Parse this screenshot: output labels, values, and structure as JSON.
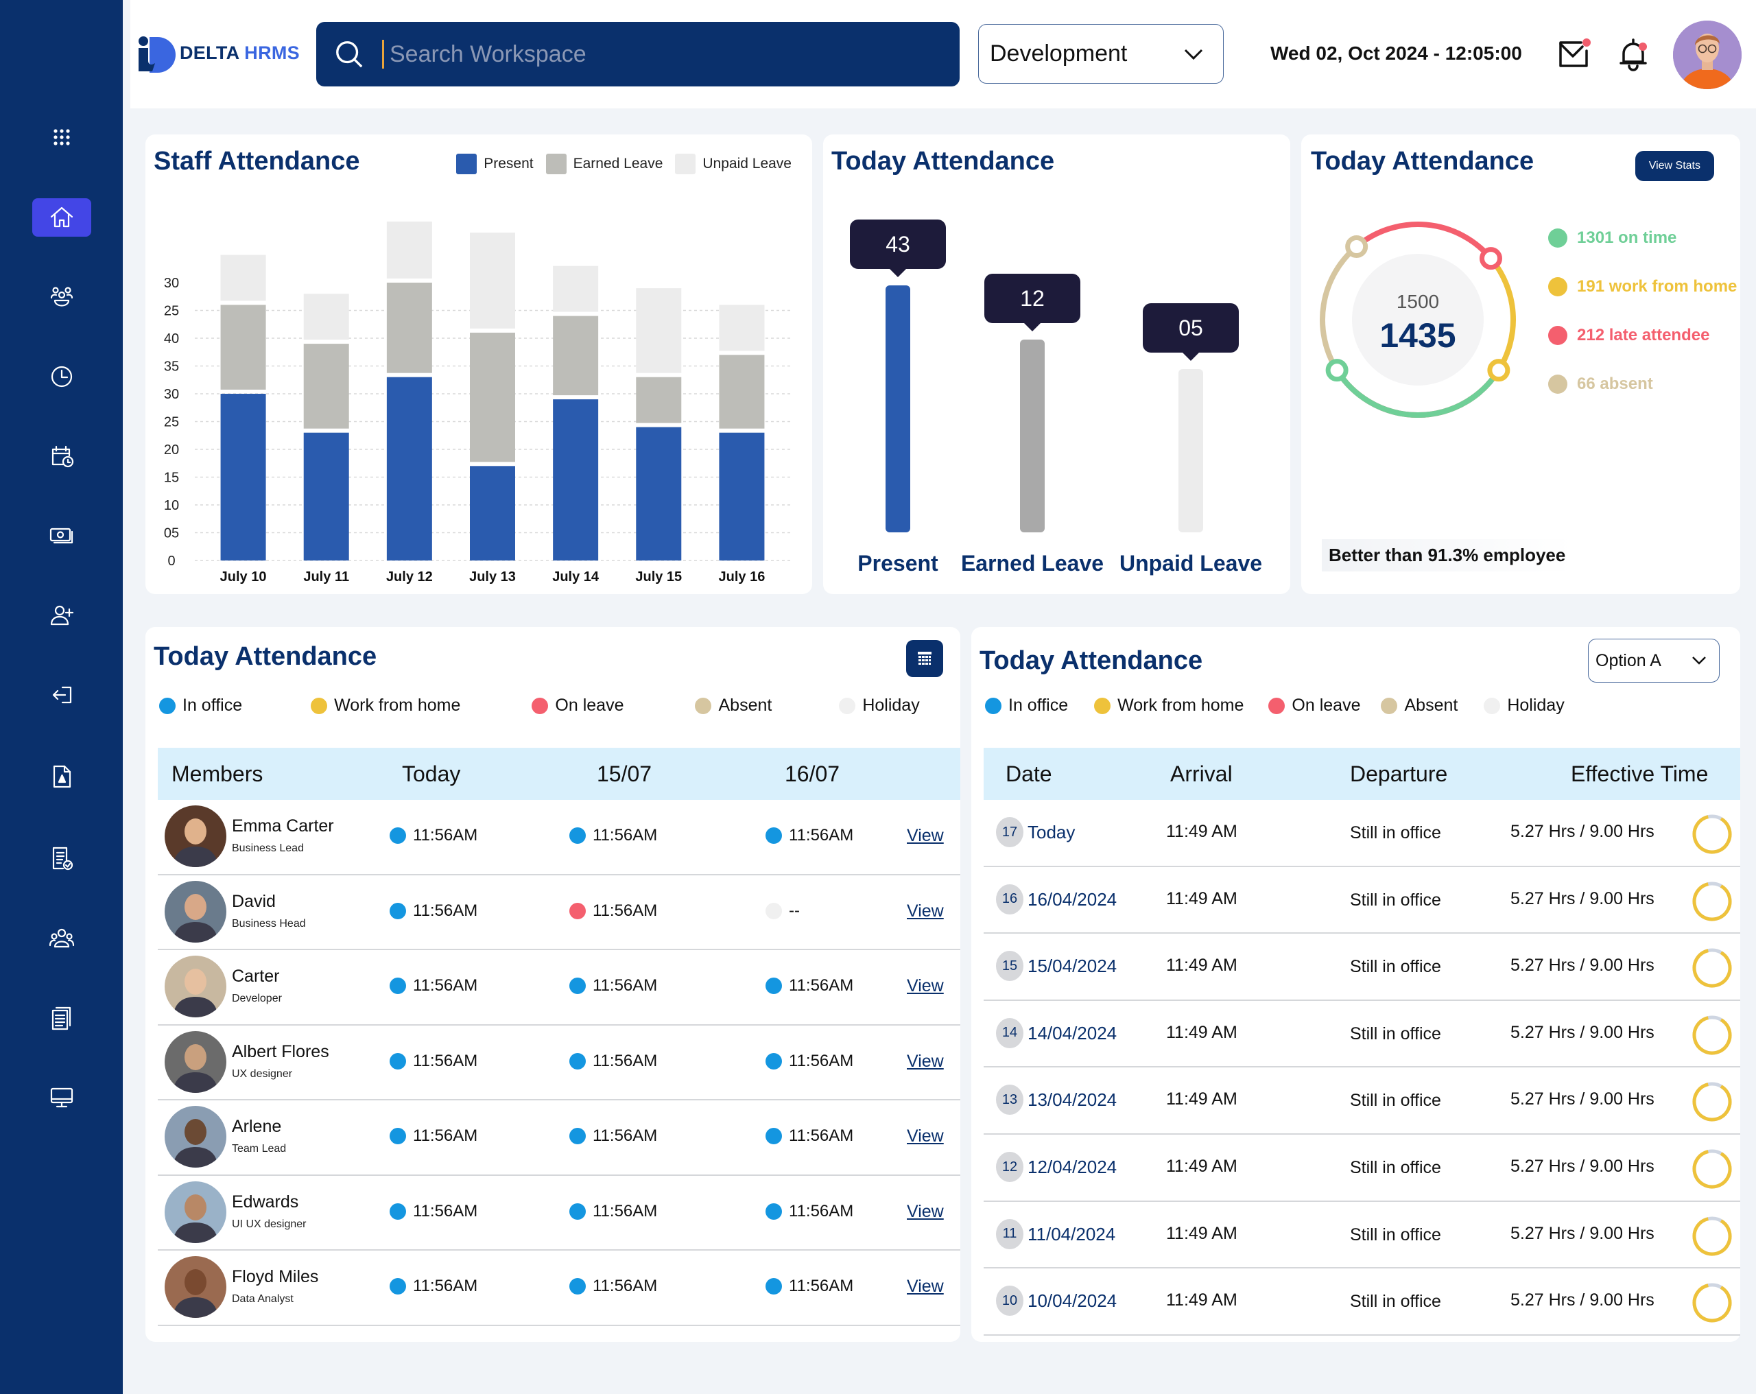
{
  "sidebar": {
    "items": [
      {
        "name": "apps-grid",
        "active": false
      },
      {
        "name": "home",
        "active": true
      },
      {
        "name": "team",
        "active": false
      },
      {
        "name": "clock",
        "active": false
      },
      {
        "name": "calendar-clock",
        "active": false
      },
      {
        "name": "payroll",
        "active": false
      },
      {
        "name": "add-user",
        "active": false
      },
      {
        "name": "logout",
        "active": false
      },
      {
        "name": "pdf-document",
        "active": false
      },
      {
        "name": "checklist",
        "active": false
      },
      {
        "name": "groups",
        "active": false
      },
      {
        "name": "documents",
        "active": false
      },
      {
        "name": "monitor",
        "active": false
      }
    ]
  },
  "header": {
    "logo_part1": "DELTA",
    "logo_part2": "HRMS",
    "search_placeholder": "Search Workspace",
    "department": "Development",
    "datetime": "Wed 02, Oct 2024 - 12:05:00",
    "mail_has_notification": true,
    "bell_has_notification": true
  },
  "staff_attendance": {
    "title": "Staff Attendance",
    "legend": [
      {
        "label": "Present",
        "color": "#2a5bae"
      },
      {
        "label": "Earned Leave",
        "color": "#bdbdb8"
      },
      {
        "label": "Unpaid Leave",
        "color": "#ececec"
      }
    ]
  },
  "today_bars": {
    "title": "Today Attendance",
    "items": [
      {
        "label": "Present",
        "value": "43",
        "color": "#2a5bae"
      },
      {
        "label": "Earned Leave",
        "value": "12",
        "color": "#a9a9a9"
      },
      {
        "label": "Unpaid Leave",
        "value": "05",
        "color": "#ececec"
      }
    ]
  },
  "today_ring": {
    "title": "Today Attendance",
    "view_stats": "View Stats",
    "total": "1500",
    "present": "1435",
    "legend": [
      {
        "label": "1301 on time",
        "color": "#6fcf97"
      },
      {
        "label": "191 work from home",
        "color": "#eec23b"
      },
      {
        "label": "212 late attendee",
        "color": "#f45f6e"
      },
      {
        "label": "66 absent",
        "color": "#d6c6a0"
      }
    ],
    "better_than": "Better than 91.3% employee"
  },
  "status_legend": [
    {
      "label": "In office",
      "color": "#1496e0"
    },
    {
      "label": "Work from home",
      "color": "#eec23b"
    },
    {
      "label": "On leave",
      "color": "#f45f6e"
    },
    {
      "label": "Absent",
      "color": "#d6c6a0"
    },
    {
      "label": "Holiday",
      "color": "#f0f0f0"
    }
  ],
  "members_table": {
    "title": "Today Attendance",
    "headers": [
      "Members",
      "Today",
      "15/07",
      "16/07"
    ],
    "view_label": "View",
    "rows": [
      {
        "name": "Emma Carter",
        "role": "Business Lead",
        "cells": [
          {
            "status": "In office",
            "time": "11:56AM"
          },
          {
            "status": "In office",
            "time": "11:56AM"
          },
          {
            "status": "In office",
            "time": "11:56AM"
          }
        ]
      },
      {
        "name": "David",
        "role": "Business Head",
        "cells": [
          {
            "status": "In office",
            "time": "11:56AM"
          },
          {
            "status": "On leave",
            "time": "11:56AM"
          },
          {
            "status": "Holiday",
            "time": "--"
          }
        ]
      },
      {
        "name": "Carter",
        "role": "Developer",
        "cells": [
          {
            "status": "In office",
            "time": "11:56AM"
          },
          {
            "status": "In office",
            "time": "11:56AM"
          },
          {
            "status": "In office",
            "time": "11:56AM"
          }
        ]
      },
      {
        "name": "Albert Flores",
        "role": "UX designer",
        "cells": [
          {
            "status": "In office",
            "time": "11:56AM"
          },
          {
            "status": "In office",
            "time": "11:56AM"
          },
          {
            "status": "In office",
            "time": "11:56AM"
          }
        ]
      },
      {
        "name": "Arlene",
        "role": "Team Lead",
        "cells": [
          {
            "status": "In office",
            "time": "11:56AM"
          },
          {
            "status": "In office",
            "time": "11:56AM"
          },
          {
            "status": "In office",
            "time": "11:56AM"
          }
        ]
      },
      {
        "name": "Edwards",
        "role": "UI UX designer",
        "cells": [
          {
            "status": "In office",
            "time": "11:56AM"
          },
          {
            "status": "In office",
            "time": "11:56AM"
          },
          {
            "status": "In office",
            "time": "11:56AM"
          }
        ]
      },
      {
        "name": "Floyd Miles",
        "role": "Data Analyst",
        "cells": [
          {
            "status": "In office",
            "time": "11:56AM"
          },
          {
            "status": "In office",
            "time": "11:56AM"
          },
          {
            "status": "In office",
            "time": "11:56AM"
          }
        ]
      }
    ]
  },
  "log_table": {
    "title": "Today Attendance",
    "option_selected": "Option A",
    "headers": [
      "Date",
      "Arrival",
      "Departure",
      "Effective Time"
    ],
    "rows": [
      {
        "day": "17",
        "date": "Today",
        "arrival": "11:49 AM",
        "departure": "Still in office",
        "effective": "5.27 Hrs / 9.00 Hrs",
        "ring_progress": 0.88
      },
      {
        "day": "16",
        "date": "16/04/2024",
        "arrival": "11:49 AM",
        "departure": "Still in office",
        "effective": "5.27 Hrs / 9.00 Hrs",
        "ring_progress": 0.88
      },
      {
        "day": "15",
        "date": "15/04/2024",
        "arrival": "11:49 AM",
        "departure": "Still in office",
        "effective": "5.27 Hrs / 9.00 Hrs",
        "ring_progress": 0.88
      },
      {
        "day": "14",
        "date": "14/04/2024",
        "arrival": "11:49 AM",
        "departure": "Still in office",
        "effective": "5.27 Hrs / 9.00 Hrs",
        "ring_progress": 0.88
      },
      {
        "day": "13",
        "date": "13/04/2024",
        "arrival": "11:49 AM",
        "departure": "Still in office",
        "effective": "5.27 Hrs / 9.00 Hrs",
        "ring_progress": 0.88
      },
      {
        "day": "12",
        "date": "12/04/2024",
        "arrival": "11:49 AM",
        "departure": "Still in office",
        "effective": "5.27 Hrs / 9.00 Hrs",
        "ring_progress": 0.88
      },
      {
        "day": "11",
        "date": "11/04/2024",
        "arrival": "11:49 AM",
        "departure": "Still in office",
        "effective": "5.27 Hrs / 9.00 Hrs",
        "ring_progress": 0.88
      },
      {
        "day": "10",
        "date": "10/04/2024",
        "arrival": "11:49 AM",
        "departure": "Still in office",
        "effective": "5.27 Hrs / 9.00 Hrs",
        "ring_progress": 0.88
      }
    ]
  },
  "chart_data": [
    {
      "type": "bar",
      "stacked": true,
      "title": "Staff Attendance",
      "categories": [
        "July 10",
        "July 11",
        "July 12",
        "July 13",
        "July 14",
        "July 15",
        "July 16"
      ],
      "series": [
        {
          "name": "Present",
          "values": [
            30,
            23,
            33,
            17,
            29,
            24,
            23
          ]
        },
        {
          "name": "Earned Leave",
          "values": [
            16,
            16,
            17,
            24,
            15,
            9,
            14
          ]
        },
        {
          "name": "Unpaid Leave",
          "values": [
            9,
            9,
            11,
            18,
            9,
            16,
            9
          ]
        }
      ],
      "ytick_labels": [
        "0",
        "05",
        "10",
        "15",
        "20",
        "25",
        "30",
        "35",
        "40",
        "25",
        "30"
      ],
      "ylim": [
        0,
        60
      ],
      "grid": true,
      "legend": "top-right"
    },
    {
      "type": "bar",
      "title": "Today Attendance",
      "categories": [
        "Present",
        "Earned Leave",
        "Unpaid Leave"
      ],
      "values": [
        43,
        12,
        5
      ],
      "data_labels": [
        "43",
        "12",
        "05"
      ]
    },
    {
      "type": "pie",
      "title": "Today Attendance",
      "center_labels": [
        "1500",
        "1435"
      ],
      "categories": [
        "on time",
        "work from home",
        "late attendee",
        "absent"
      ],
      "values": [
        1301,
        191,
        212,
        66
      ]
    }
  ]
}
